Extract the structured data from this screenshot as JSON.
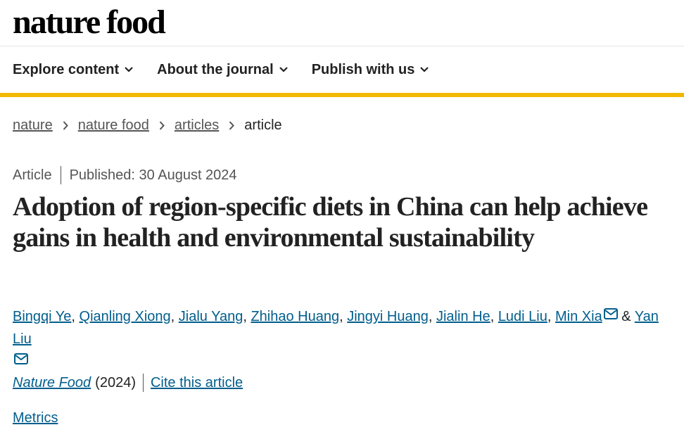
{
  "header": {
    "logo": "nature food"
  },
  "nav": {
    "items": [
      {
        "label": "Explore content"
      },
      {
        "label": "About the journal"
      },
      {
        "label": "Publish with us"
      }
    ]
  },
  "breadcrumb": {
    "items": [
      "nature",
      "nature food",
      "articles"
    ],
    "current": "article"
  },
  "article": {
    "type": "Article",
    "published": "Published: 30 August 2024",
    "title": "Adoption of region-specific diets in China can help achieve gains in health and environmental sustainability",
    "authors": [
      "Bingqi Ye",
      "Qianling Xiong",
      "Jialu Yang",
      "Zhihao Huang",
      "Jingyi Huang",
      "Jialin He",
      "Ludi Liu",
      "Min Xia",
      "Yan Liu"
    ],
    "author_sep": ",",
    "author_amp": "&",
    "journal": "Nature Food",
    "year": "(2024)",
    "cite_label": "Cite this article",
    "metrics_label": "Metrics"
  },
  "colors": {
    "accent": "#f2b800",
    "link": "#025e8d"
  }
}
